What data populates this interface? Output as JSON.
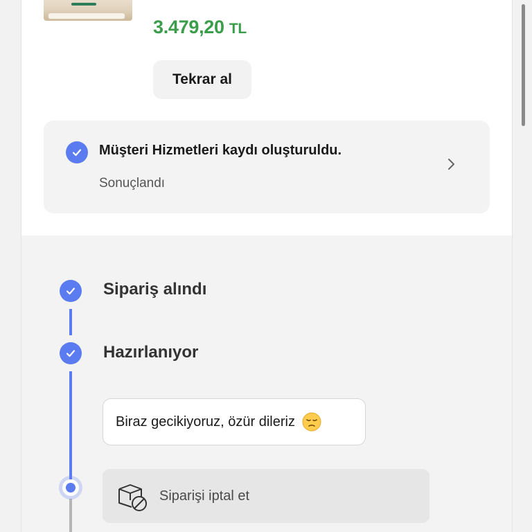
{
  "product": {
    "price_amount": "3.479,20",
    "price_currency": "TL",
    "reorder_label": "Tekrar al"
  },
  "service_record": {
    "title": "Müşteri Hizmetleri kaydı oluşturuldu.",
    "status": "Sonuçlandı"
  },
  "timeline": {
    "steps": [
      {
        "label": "Sipariş alındı",
        "completed": true
      },
      {
        "label": "Hazırlanıyor",
        "completed": true
      }
    ],
    "delay_message": "Biraz gecikiyoruz, özür dileriz",
    "cancel_label": "Siparişi iptal et"
  },
  "colors": {
    "accent": "#5b7cf0",
    "price": "#3a9d4a",
    "box_bg": "#f3f3f3"
  },
  "icons": {
    "check": "check-icon",
    "chevron": "chevron-right-icon",
    "emoji": "pensive-face-emoji",
    "cancel": "box-cancel-icon"
  }
}
